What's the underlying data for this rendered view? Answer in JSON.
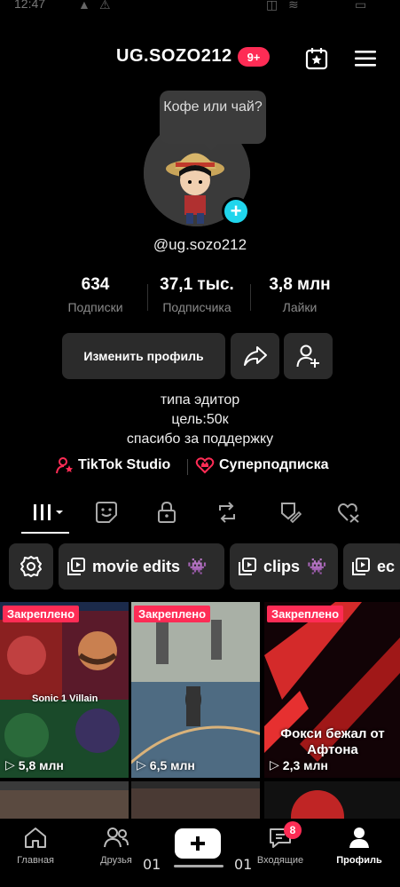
{
  "status_bar": {
    "time": "12:47"
  },
  "header": {
    "username": "UG.SOZO212",
    "notification_badge": "9+"
  },
  "profile": {
    "note": "Кофе или чай?",
    "handle": "@ug.sozo212",
    "stats": [
      {
        "value": "634",
        "label": "Подписки"
      },
      {
        "value": "37,1 тыс.",
        "label": "Подписчика"
      },
      {
        "value": "3,8 млн",
        "label": "Лайки"
      }
    ],
    "edit_button": "Изменить профиль",
    "bio": [
      "типа эдитор",
      "цель:50к",
      "спасибо за поддержку"
    ],
    "links": {
      "studio": "TikTok Studio",
      "subscription": "Суперподписка"
    }
  },
  "tabs": [
    "videos-grid",
    "private",
    "locked",
    "reposts",
    "favorites",
    "liked"
  ],
  "playlists": [
    {
      "label": "movie edits"
    },
    {
      "label": "clips"
    },
    {
      "label": "ec"
    }
  ],
  "videos": [
    {
      "pinned": "Закреплено",
      "views": "5,8 млн",
      "caption": "Sonic 1 Villain"
    },
    {
      "pinned": "Закреплено",
      "views": "6,5 млн",
      "caption": ""
    },
    {
      "pinned": "Закреплено",
      "views": "2,3 млн",
      "caption": "Фокси бежал от Афтона"
    }
  ],
  "bottom_nav": {
    "items": [
      {
        "label": "Главная"
      },
      {
        "label": "Друзья"
      },
      {
        "label": ""
      },
      {
        "label": "Входящие"
      },
      {
        "label": "Профиль"
      }
    ],
    "inbox_badge": "8"
  },
  "overlay": {
    "left_num": "01",
    "right_num": "01"
  },
  "colors": {
    "accent": "#fe2c55",
    "cyan": "#20d5ec",
    "background": "#000000",
    "button_bg": "#2b2b2b"
  }
}
